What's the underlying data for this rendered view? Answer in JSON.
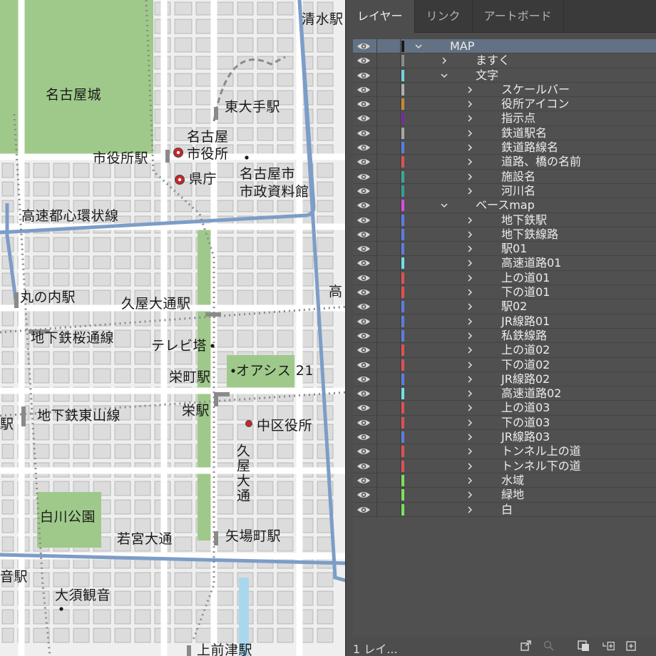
{
  "map": {
    "labels": [
      {
        "id": "nagoya-castle",
        "text": "名古屋城"
      },
      {
        "id": "shiyakusho-station",
        "text": "市役所駅"
      },
      {
        "id": "nagoya-cityhall",
        "text": "名古屋\n市役所"
      },
      {
        "id": "prefecture-office",
        "text": "県庁"
      },
      {
        "id": "higashi-ote-station",
        "text": "東大手駅"
      },
      {
        "id": "shimizu-station",
        "text": "清水駅"
      },
      {
        "id": "city-archives",
        "text": "名古屋市\n市政資料館"
      },
      {
        "id": "expressway-ring",
        "text": "高速都心環状線"
      },
      {
        "id": "marunouchi-station",
        "text": "丸の内駅"
      },
      {
        "id": "hisaya-odori-station",
        "text": "久屋大通駅"
      },
      {
        "id": "subway-sakuradori",
        "text": "地下鉄桜通線"
      },
      {
        "id": "tv-tower",
        "text": "テレビ塔"
      },
      {
        "id": "oasis21",
        "text": "オアシス 21"
      },
      {
        "id": "sakae-machi-station",
        "text": "栄町駅"
      },
      {
        "id": "sakae-station",
        "text": "栄駅"
      },
      {
        "id": "subway-higashiyama",
        "text": "地下鉄東山線"
      },
      {
        "id": "naka-ward-office",
        "text": "中区役所"
      },
      {
        "id": "hisaya-odori",
        "text": "久屋大通"
      },
      {
        "id": "shirakawa-park",
        "text": "白川公園"
      },
      {
        "id": "wakamiya-odori",
        "text": "若宮大通"
      },
      {
        "id": "yaba-cho-station",
        "text": "矢場町駅"
      },
      {
        "id": "osu-kannon-station",
        "text": "音駅"
      },
      {
        "id": "osu-kannon",
        "text": "大須観音"
      },
      {
        "id": "kamimaezu-station",
        "text": "上前津駅"
      },
      {
        "id": "left-station-fragment",
        "text": "駅"
      },
      {
        "id": "right-edge-fragment",
        "text": "高"
      }
    ]
  },
  "panel": {
    "tabs": [
      "レイヤー",
      "リンク",
      "アートボード"
    ],
    "layers": [
      {
        "name": "MAP",
        "color": "#1a1a1a",
        "depth": 0,
        "expanded": true,
        "selected": true
      },
      {
        "name": "ますく",
        "color": "#8a8a8a",
        "depth": 1,
        "expanded": false
      },
      {
        "name": "文字",
        "color": "#6fd4e0",
        "depth": 1,
        "expanded": true
      },
      {
        "name": "スケールバー",
        "color": "#b0b0b0",
        "depth": 2,
        "expanded": false
      },
      {
        "name": "役所アイコン",
        "color": "#c68a2e",
        "depth": 2,
        "expanded": false
      },
      {
        "name": "指示点",
        "color": "#7a2a9a",
        "depth": 2,
        "expanded": false
      },
      {
        "name": "鉄道駅名",
        "color": "#a8a8a8",
        "depth": 2,
        "expanded": false
      },
      {
        "name": "鉄道路線名",
        "color": "#5b7de0",
        "depth": 2,
        "expanded": false
      },
      {
        "name": "道路、橋の名前",
        "color": "#e05050",
        "depth": 2,
        "expanded": false
      },
      {
        "name": "施設名",
        "color": "#3aa89a",
        "depth": 2,
        "expanded": false
      },
      {
        "name": "河川名",
        "color": "#3a9a9a",
        "depth": 2,
        "expanded": false
      },
      {
        "name": "ベースmap",
        "color": "#e048e0",
        "depth": 1,
        "expanded": true
      },
      {
        "name": "地下鉄駅",
        "color": "#5b7de0",
        "depth": 2,
        "expanded": false
      },
      {
        "name": "地下鉄線路",
        "color": "#5b7de0",
        "depth": 2,
        "expanded": false
      },
      {
        "name": "駅01",
        "color": "#5b7de0",
        "depth": 2,
        "expanded": false
      },
      {
        "name": "高速道路01",
        "color": "#6fe0e8",
        "depth": 2,
        "expanded": false
      },
      {
        "name": "上の道01",
        "color": "#e05050",
        "depth": 2,
        "expanded": false
      },
      {
        "name": "下の道01",
        "color": "#e05050",
        "depth": 2,
        "expanded": false
      },
      {
        "name": "駅02",
        "color": "#5b7de0",
        "depth": 2,
        "expanded": false
      },
      {
        "name": "JR線路01",
        "color": "#5b7de0",
        "depth": 2,
        "expanded": false
      },
      {
        "name": "私鉄線路",
        "color": "#5b7de0",
        "depth": 2,
        "expanded": false
      },
      {
        "name": "上の道02",
        "color": "#e05050",
        "depth": 2,
        "expanded": false
      },
      {
        "name": "下の道02",
        "color": "#e05050",
        "depth": 2,
        "expanded": false
      },
      {
        "name": "JR線路02",
        "color": "#5b7de0",
        "depth": 2,
        "expanded": false
      },
      {
        "name": "高速道路02",
        "color": "#6fe0e8",
        "depth": 2,
        "expanded": false
      },
      {
        "name": "上の道03",
        "color": "#e05050",
        "depth": 2,
        "expanded": false
      },
      {
        "name": "下の道03",
        "color": "#e05050",
        "depth": 2,
        "expanded": false
      },
      {
        "name": "JR線路03",
        "color": "#5b7de0",
        "depth": 2,
        "expanded": false
      },
      {
        "name": "トンネル上の道",
        "color": "#e05050",
        "depth": 2,
        "expanded": false
      },
      {
        "name": "トンネル下の道",
        "color": "#e05050",
        "depth": 2,
        "expanded": false
      },
      {
        "name": "水域",
        "color": "#7ee05a",
        "depth": 2,
        "expanded": false
      },
      {
        "name": "緑地",
        "color": "#7ee05a",
        "depth": 2,
        "expanded": false
      },
      {
        "name": "白",
        "color": "#7ee05a",
        "depth": 2,
        "expanded": false
      }
    ],
    "footer": {
      "layer_count": "1 レイ...",
      "icons": [
        "export-icon",
        "search-icon",
        "make-clipping-mask-icon",
        "new-sublayer-icon",
        "new-layer-icon"
      ]
    }
  }
}
